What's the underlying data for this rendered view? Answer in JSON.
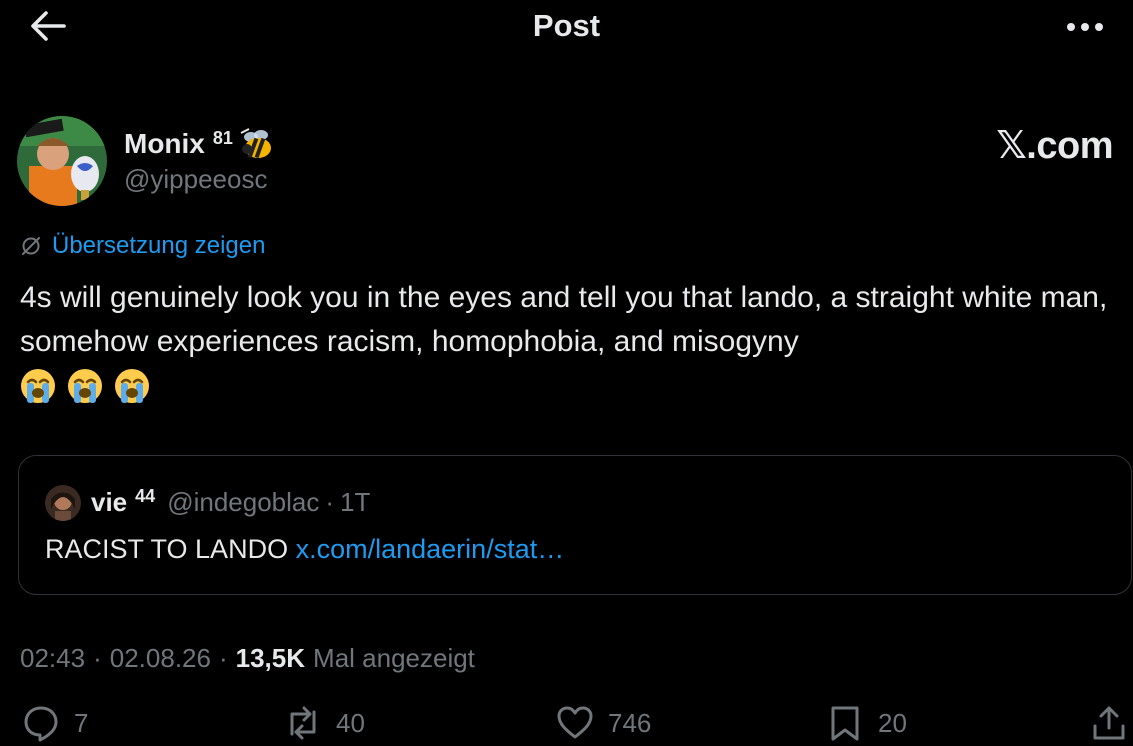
{
  "header": {
    "title": "Post"
  },
  "author": {
    "name": "Monix",
    "badge": "81",
    "handle": "@yippeeosc"
  },
  "brand": {
    "logo_text": "𝕏.com"
  },
  "translate": {
    "label": "Übersetzung zeigen"
  },
  "post": {
    "text": "4s will genuinely look you in the eyes and tell you that lando, a straight white man, somehow experiences racism, homophobia, and misogyny"
  },
  "quote": {
    "name": "vie",
    "badge": "44",
    "handle": "@indegoblac",
    "dot": "·",
    "time": "1T",
    "text": "RACIST TO LANDO",
    "link": "x.com/landaerin/stat…"
  },
  "meta": {
    "time": "02:43",
    "dot1": "·",
    "date": "02.08.26",
    "dot2": "·",
    "views": "13,5K",
    "views_label": "Mal angezeigt"
  },
  "actions": {
    "replies": "7",
    "reposts": "40",
    "likes": "746",
    "bookmarks": "20"
  },
  "icons": {
    "back": "arrow-left-icon",
    "more": "more-dots-icon",
    "translate": "globe-slash-icon",
    "reply": "reply-icon",
    "repost": "repost-icon",
    "like": "heart-icon",
    "bookmark": "bookmark-icon",
    "share": "share-icon"
  },
  "colors": {
    "background": "#000000",
    "text": "#e7e9ea",
    "muted": "#71767b",
    "accent": "#1d9bf0",
    "border": "#2f3336"
  }
}
